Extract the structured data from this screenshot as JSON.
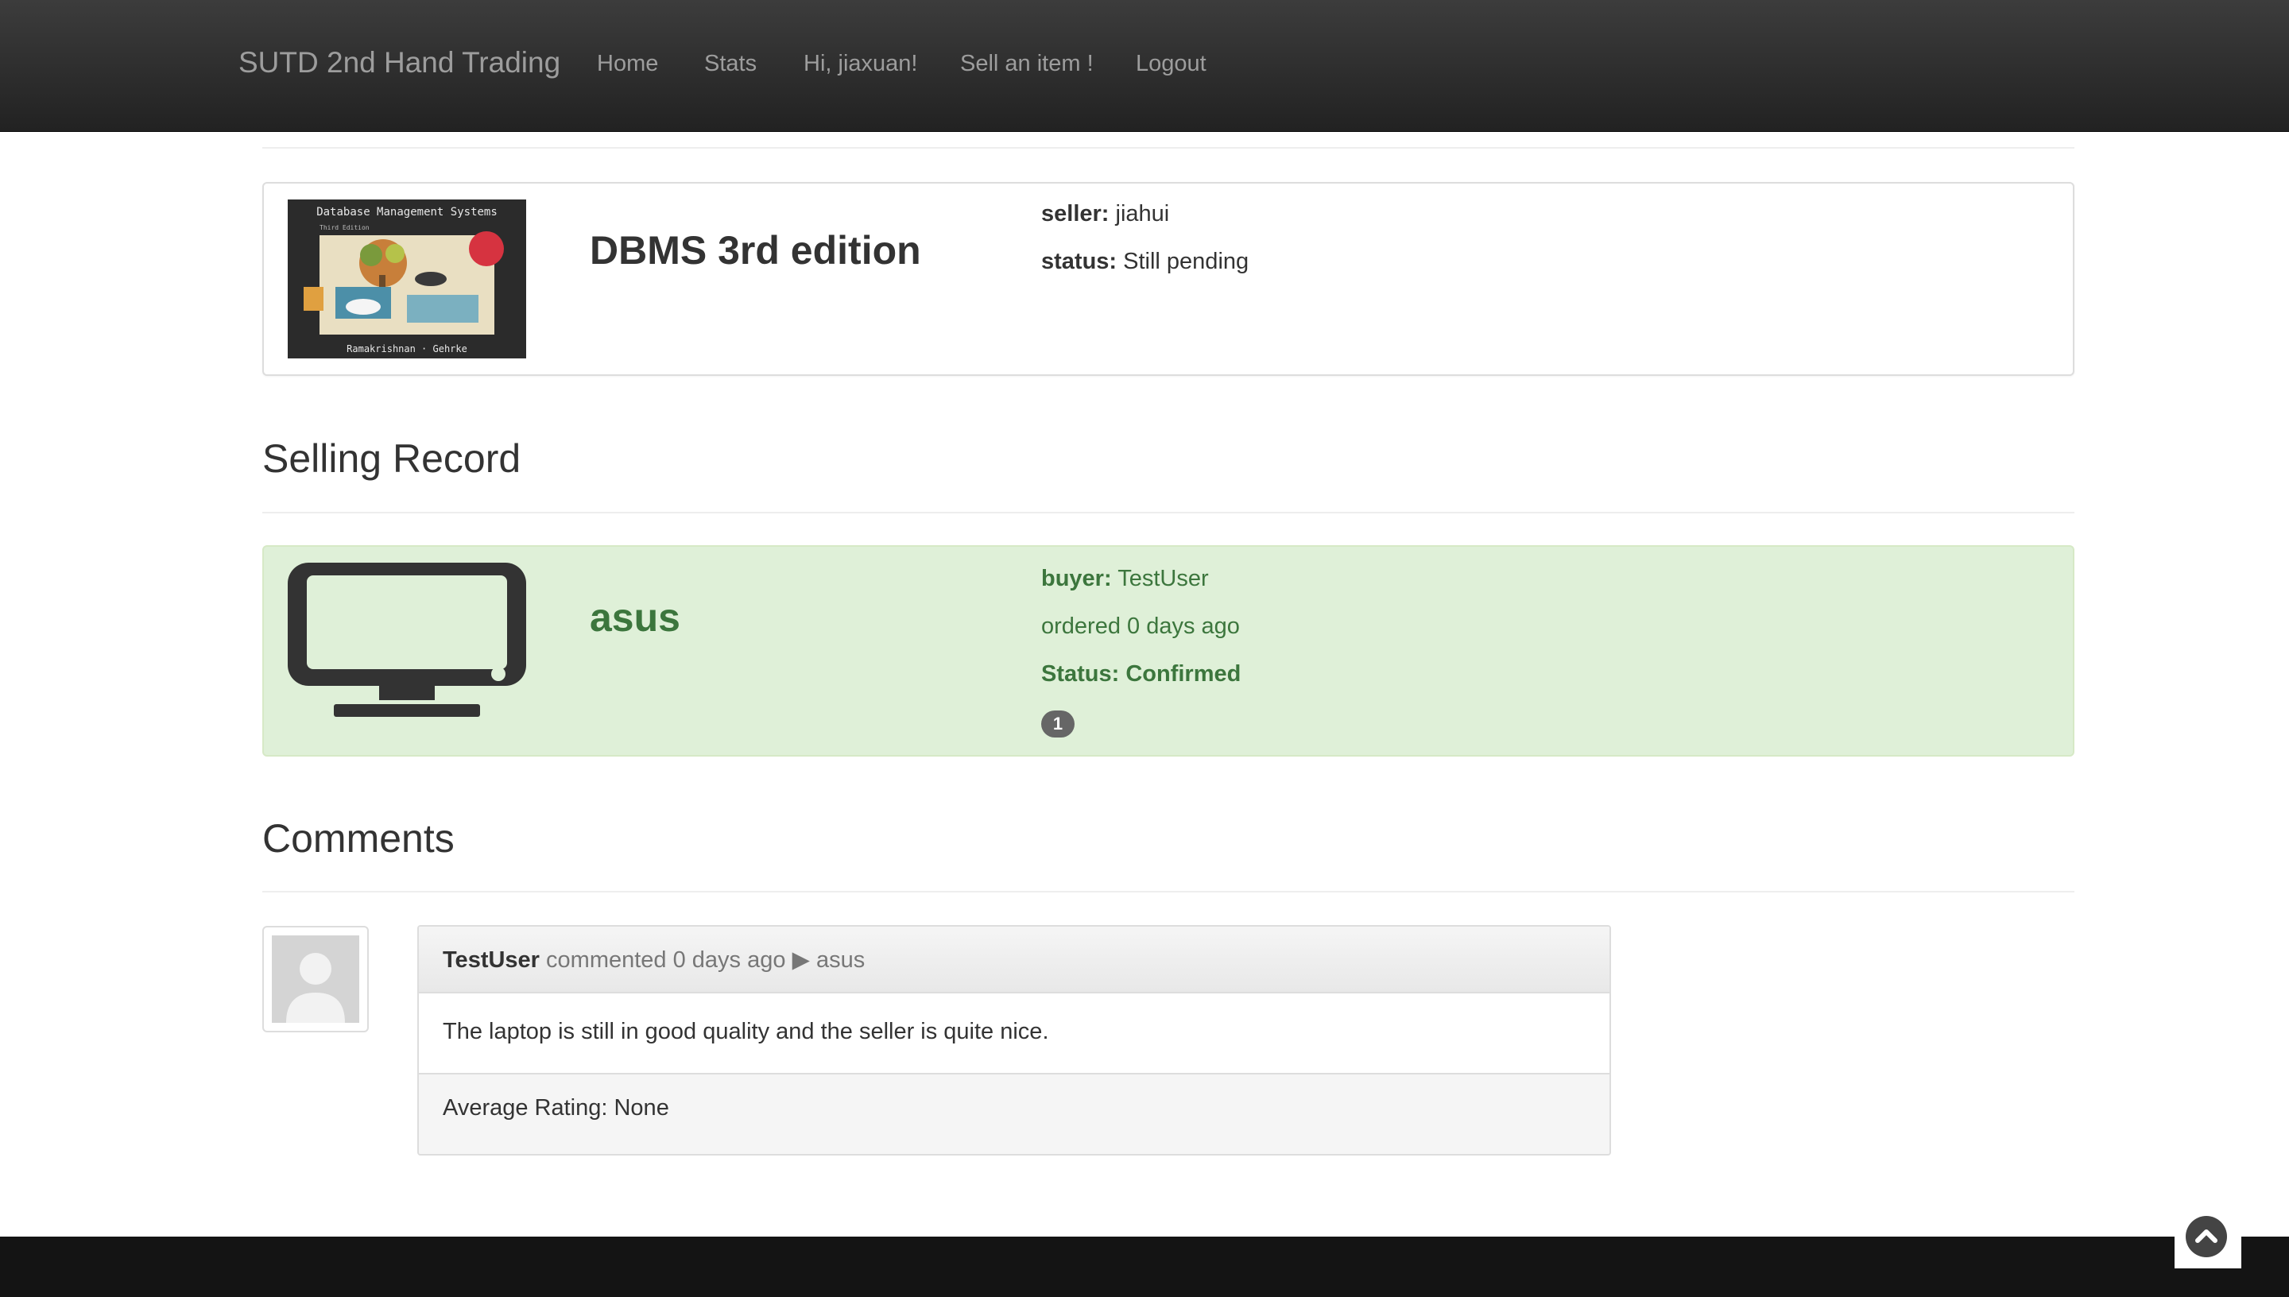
{
  "navbar": {
    "brand": "SUTD 2nd Hand Trading",
    "items": [
      "Home",
      "Stats",
      "Hi, jiaxuan!",
      "Sell an item !",
      "Logout"
    ]
  },
  "item": {
    "title": "DBMS 3rd edition",
    "cover_title": "Database Management Systems",
    "cover_edition": "Third Edition",
    "cover_authors": "Ramakrishnan · Gehrke",
    "seller_label": "seller:",
    "seller": "jiahui",
    "status_label": "status:",
    "status": "Still pending"
  },
  "selling_record": {
    "heading": "Selling Record",
    "title": "asus",
    "buyer_label": "buyer:",
    "buyer": "TestUser",
    "ordered": "ordered 0 days ago",
    "status": "Status: Confirmed",
    "badge": "1",
    "accent": "#3c763d",
    "background": "#dff0d8"
  },
  "comments": {
    "heading": "Comments",
    "author": "TestUser",
    "meta": "commented 0 days ago",
    "arrow": "▶",
    "item": "asus",
    "body": "The laptop is still in good quality and the seller is quite nice.",
    "rating": "Average Rating: None"
  },
  "icons": {
    "record_icon": "monitor-icon",
    "scroll_top": "chevron-up-circle-icon",
    "avatar": "user-placeholder-icon"
  }
}
